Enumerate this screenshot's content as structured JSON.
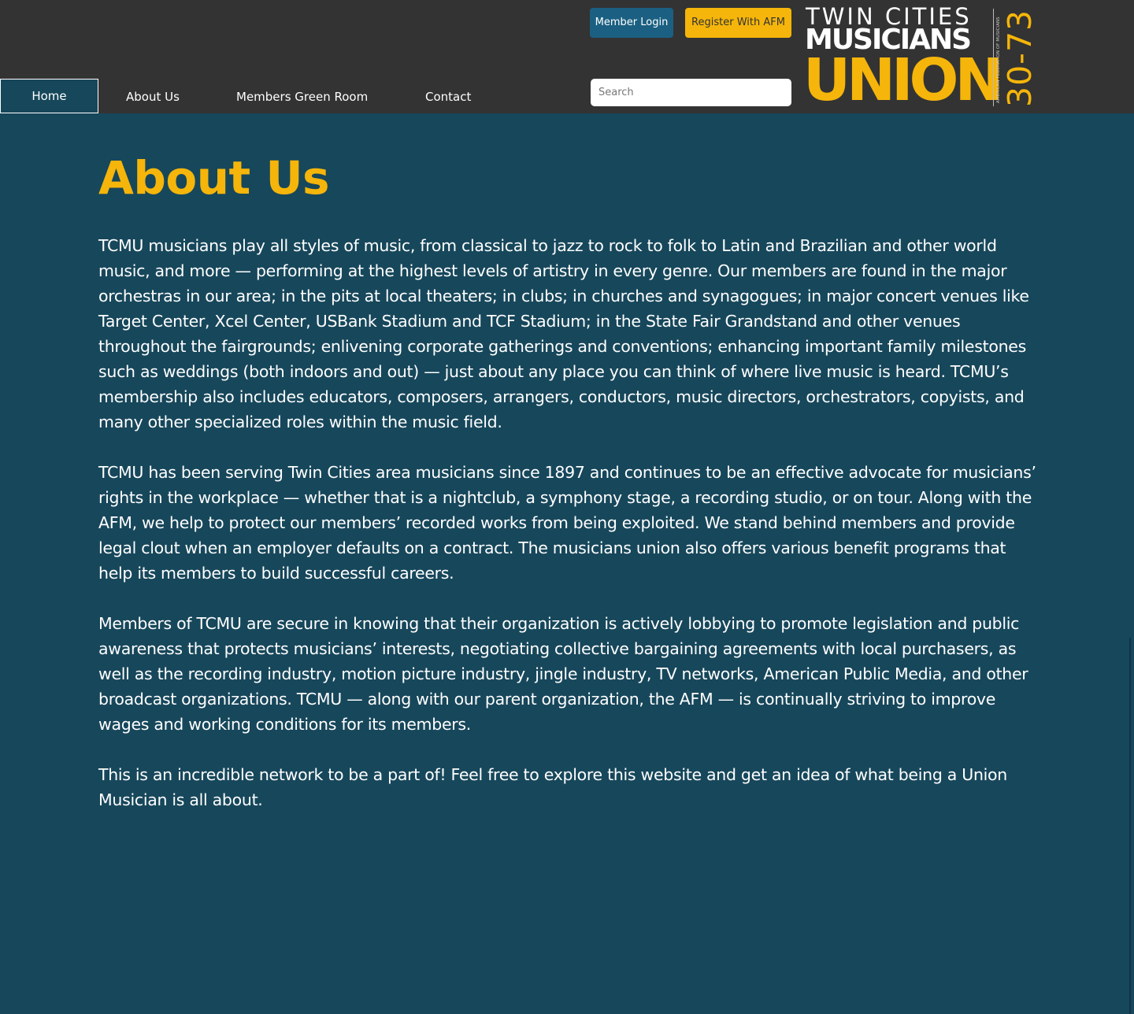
{
  "header": {
    "member_login_label": "Member Login",
    "register_label": "Register With AFM",
    "search_placeholder": "Search"
  },
  "nav": {
    "items": [
      {
        "label": "Home",
        "active": true
      },
      {
        "label": "About Us"
      },
      {
        "label": "Members Green Room"
      },
      {
        "label": "Contact"
      }
    ]
  },
  "logo": {
    "line1": "TWIN CITIES",
    "line2": "MUSICIANS",
    "line3": "UNION",
    "side_text": "AMERICAN FEDERATION OF MUSICIANS",
    "local_number": "30-73"
  },
  "main": {
    "title": "About Us",
    "paragraphs": [
      "TCMU musicians play all styles of music, from classical to jazz to rock to folk to Latin and Brazilian and other world music, and more — performing at the highest levels of artistry in every genre. Our members are found in the major orchestras in our area; in the pits at local theaters; in clubs; in churches and synagogues; in major concert venues like Target Center, Xcel Center, USBank Stadium and TCF Stadium; in the State Fair Grandstand and other venues throughout the fairgrounds; enlivening corporate gatherings and conventions; enhancing important family milestones such as weddings (both indoors and out) — just about any place you can think of where live music is heard. TCMU’s membership also includes educators, composers, arrangers, conductors, music directors, orchestrators, copyists, and many other specialized roles within the music field.",
      "TCMU has been serving Twin Cities area musicians since 1897 and continues to be an effective advocate for musicians’ rights in the workplace — whether that is a nightclub, a symphony stage, a recording studio, or on tour. Along with the AFM, we help to protect our members’ recorded works from being exploited. We stand behind members and provide legal clout when an employer defaults on a contract. The musicians union also offers various benefit programs that help its members to build successful careers.",
      "Members of TCMU are secure in knowing that their organization is actively lobbying to promote legislation and public awareness that protects musicians’ interests, negotiating collective bargaining agreements with local purchasers, as well as the recording industry, motion picture industry, jingle industry, TV networks, American Public Media, and other broadcast organizations. TCMU — along with our parent organization, the AFM — is continually striving to improve wages and working conditions for its members.",
      "This is an incredible network to be a part of! Feel free to explore this website and get an idea of what being a Union Musician is all about."
    ]
  },
  "colors": {
    "header_bg": "#333333",
    "page_bg": "#17475b",
    "accent_yellow": "#f5b50a",
    "login_blue": "#1b6082"
  }
}
